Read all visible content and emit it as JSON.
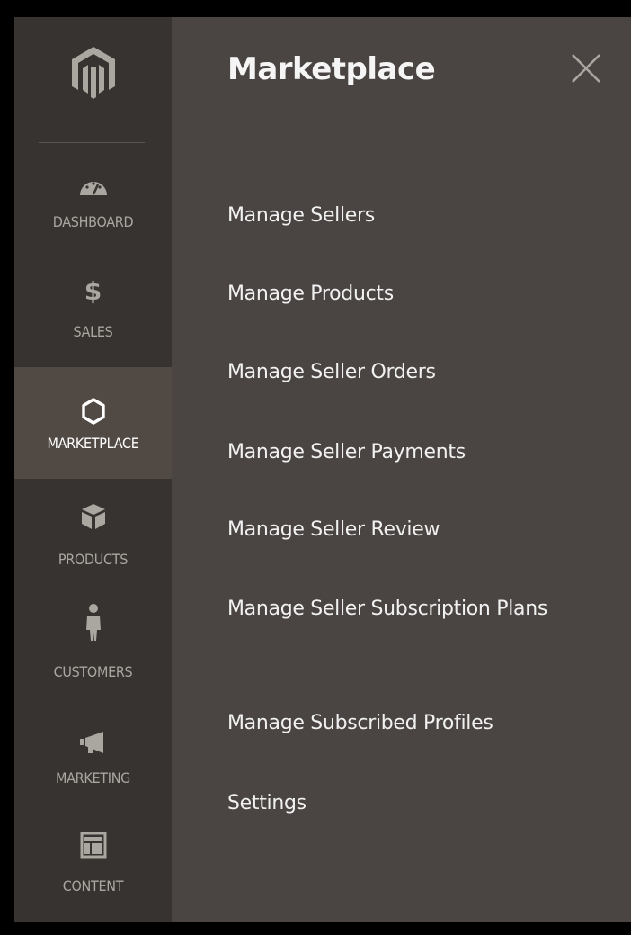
{
  "colors": {
    "sidebar_bg": "#373330",
    "sidebar_active_bg": "#514943",
    "panel_bg": "#4a4542",
    "nav_text": "#aaa6a0",
    "active_text": "#ffffff"
  },
  "sidebar": {
    "logo_icon": "magento-logo-icon",
    "items": [
      {
        "label": "DASHBOARD",
        "icon": "speedometer-icon"
      },
      {
        "label": "SALES",
        "icon": "dollar-icon"
      },
      {
        "label": "MARKETPLACE",
        "icon": "hexagon-icon",
        "active": true
      },
      {
        "label": "PRODUCTS",
        "icon": "box-icon"
      },
      {
        "label": "CUSTOMERS",
        "icon": "person-icon"
      },
      {
        "label": "MARKETING",
        "icon": "megaphone-icon"
      },
      {
        "label": "CONTENT",
        "icon": "layout-icon"
      }
    ]
  },
  "panel": {
    "title": "Marketplace",
    "close_icon": "close-icon",
    "items": [
      {
        "label": "Manage Sellers"
      },
      {
        "label": "Manage Products"
      },
      {
        "label": "Manage Seller Orders"
      },
      {
        "label": "Manage Seller Payments"
      },
      {
        "label": "Manage Seller Review"
      },
      {
        "label": "Manage Seller Subscription Plans"
      },
      {
        "label": "Manage Subscribed Profiles"
      },
      {
        "label": "Settings"
      }
    ]
  }
}
